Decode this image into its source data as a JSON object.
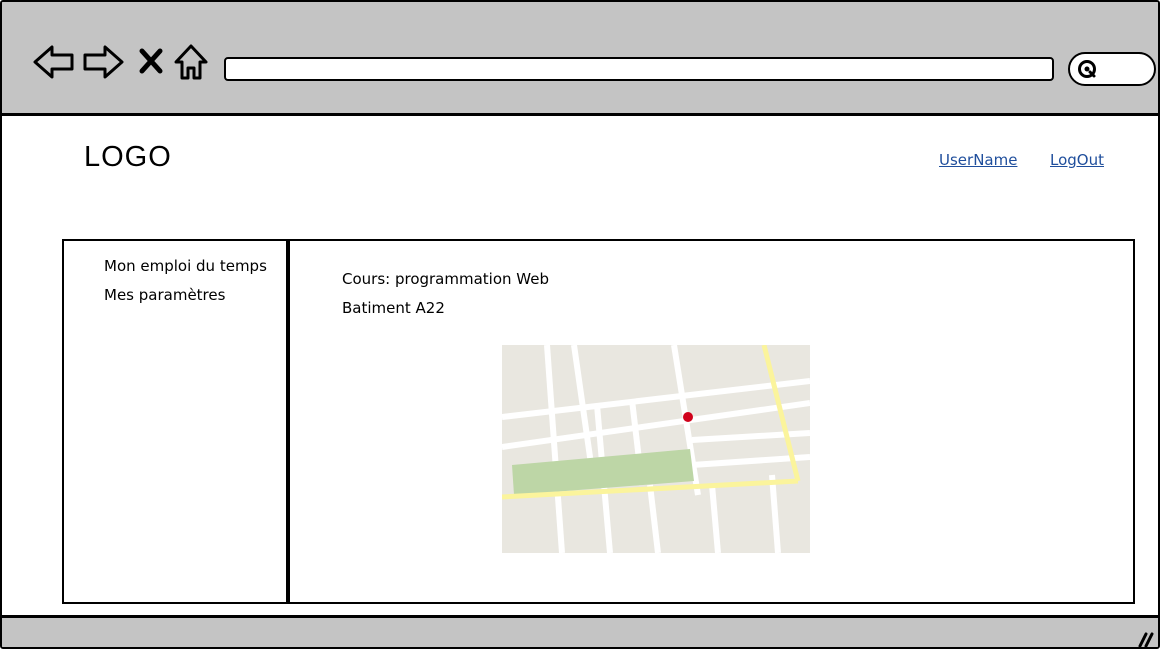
{
  "browser": {
    "nav_icons": [
      "back-arrow-icon",
      "forward-arrow-icon",
      "close-x-icon",
      "home-icon"
    ],
    "address_value": "",
    "search_icon": "search-icon"
  },
  "header": {
    "logo": "LOGO",
    "username": "UserName",
    "logout": "LogOut"
  },
  "sidebar": {
    "items": [
      {
        "label": "Mon emploi du temps"
      },
      {
        "label": "Mes paramètres"
      }
    ]
  },
  "main": {
    "course": "Cours: programmation Web",
    "building": "Batiment A22",
    "map": {
      "road_color": "#fbf49c",
      "park_color": "#bdd6a6",
      "marker_color": "#d0021b",
      "background_color": "#e9e7e0"
    }
  },
  "colors": {
    "chrome": "#c4c4c4",
    "link": "#1f4e9c"
  }
}
